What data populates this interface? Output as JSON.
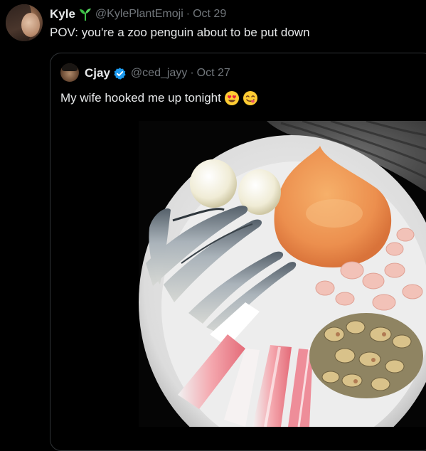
{
  "tweet": {
    "display_name": "Kyle",
    "name_icon": "plant-sprout-icon",
    "handle": "@KylePlantEmoji",
    "separator": "·",
    "date": "Oct 29",
    "text": "POV: you're a zoo penguin about to be put down"
  },
  "quote": {
    "display_name": "Cjay",
    "verified_icon": "verified-badge-icon",
    "handle": "@ced_jayy",
    "separator": "·",
    "date": "Oct 27",
    "text": "My wife hooked me up tonight",
    "emojis": [
      "heart-eyes-emoji-icon",
      "yum-face-emoji-icon"
    ]
  },
  "colors": {
    "background": "#000000",
    "text_primary": "#e7e9ea",
    "text_secondary": "#71767b",
    "border": "#2f3336",
    "verified": "#1d9bf0",
    "plant": "#3bbf45"
  }
}
